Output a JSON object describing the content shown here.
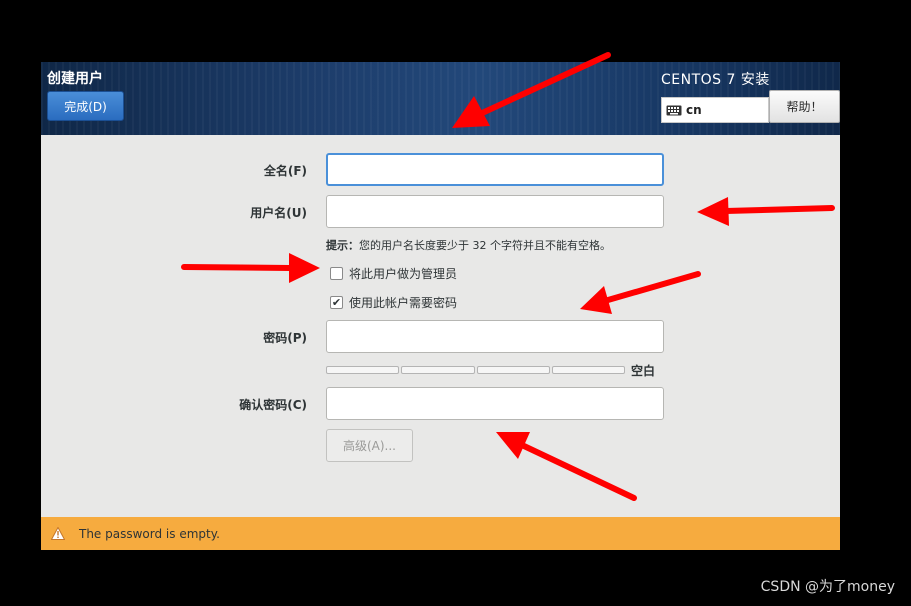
{
  "header": {
    "spoke_title": "创建用户",
    "done_label": "完成(D)",
    "product_title": "CENTOS 7 安装",
    "keyboard_layout": "cn",
    "help_label": "帮助！"
  },
  "form": {
    "fullname_label": "全名(F)",
    "fullname_value": "",
    "username_label": "用户名(U)",
    "username_value": "",
    "hint_prefix": "提示：",
    "hint_text": "您的用户名长度要少于 32 个字符并且不能有空格。",
    "admin_checkbox_label": "将此用户做为管理员",
    "admin_checked": false,
    "require_password_label": "使用此帐户需要密码",
    "require_password_checked": true,
    "password_label": "密码(P)",
    "password_value": "",
    "strength_fraction": 0,
    "strength_label": "空白",
    "confirm_label": "确认密码(C)",
    "confirm_value": "",
    "advanced_label": "高级(A)..."
  },
  "status": {
    "message": "The password is empty.",
    "color": "#f6ab3f"
  },
  "icons": {
    "keyboard": "keyboard-icon",
    "warning": "warning-icon"
  },
  "accent_colors": {
    "focus": "#4a90d9",
    "annotation_arrow": "#ff0000"
  },
  "watermark": "CSDN @为了money"
}
